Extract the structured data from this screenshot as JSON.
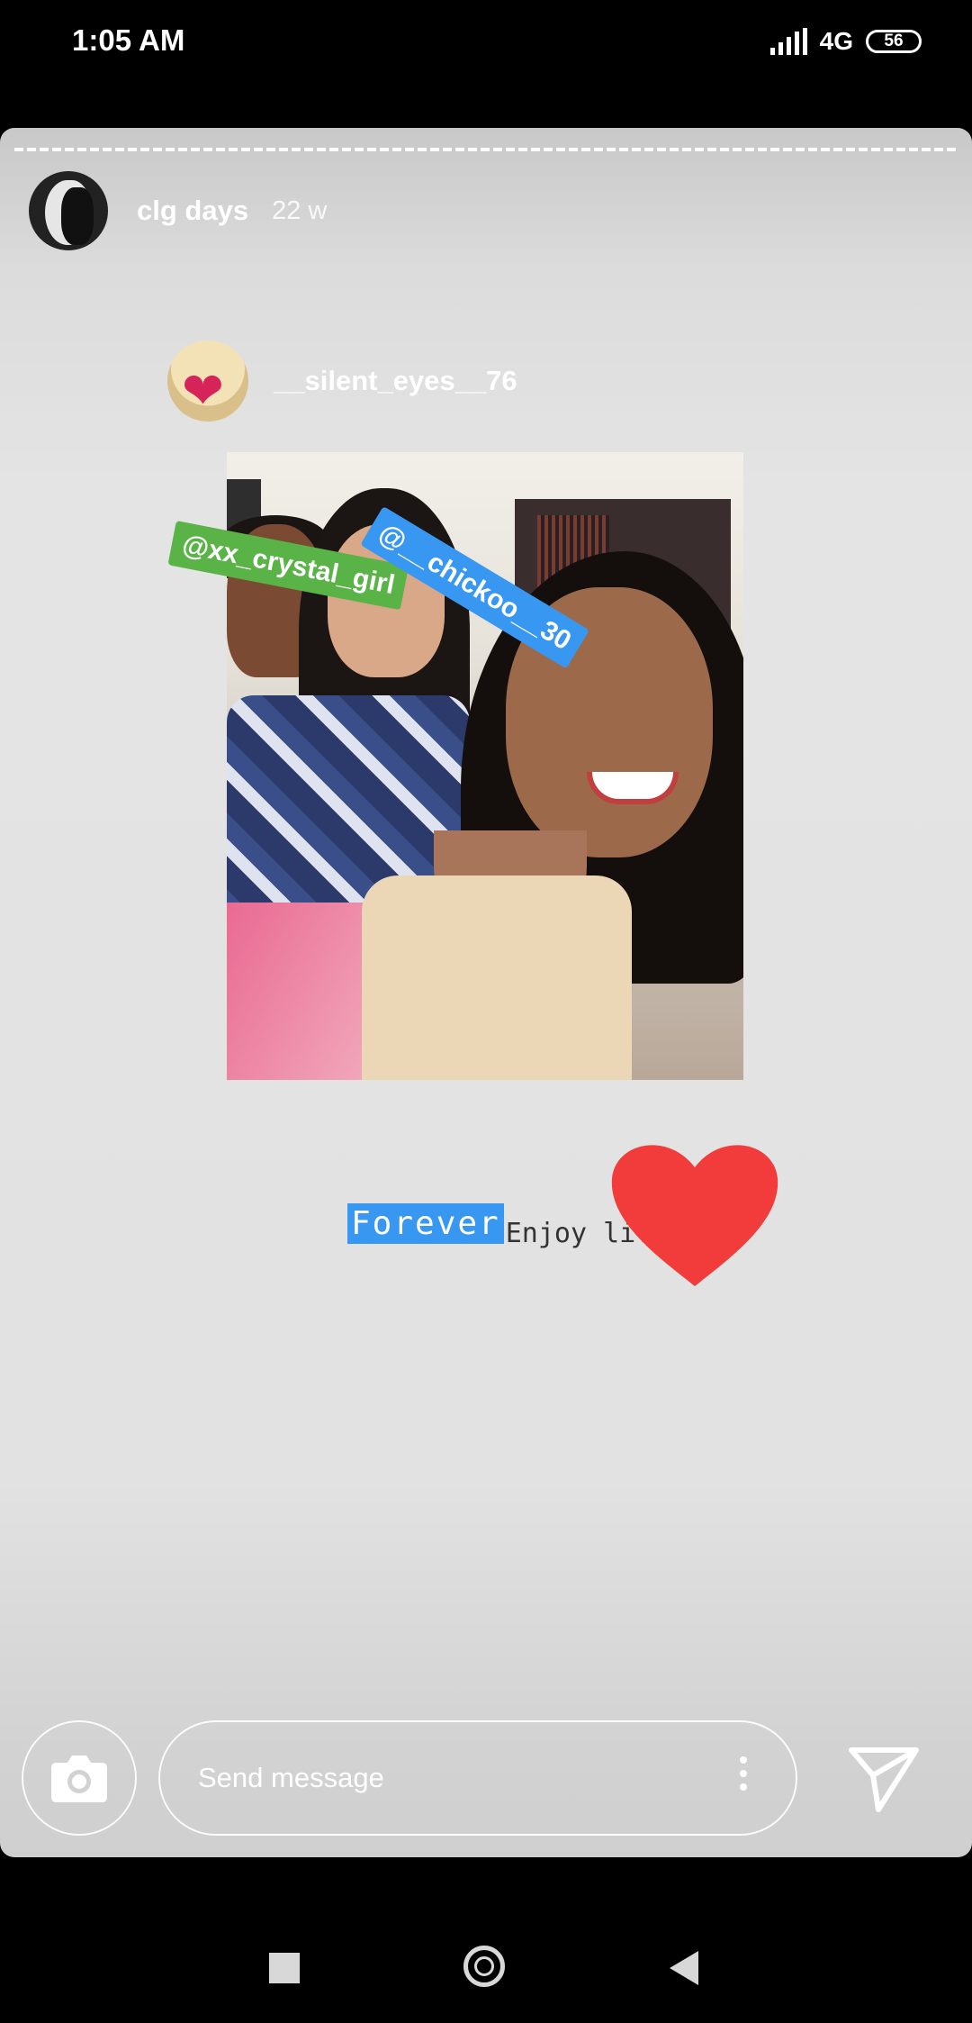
{
  "status_bar": {
    "time": "1:05 AM",
    "network": "4G",
    "battery": "56"
  },
  "story": {
    "username": "clg days",
    "time_ago": "22 w",
    "mention_username": "__silent_eyes__76",
    "tags": [
      "@xx_crystal_girl",
      "@__chickoo__30"
    ],
    "caption_highlight": "Forever",
    "caption_text": "Enjoy life"
  },
  "message_bar": {
    "placeholder": "Send message"
  },
  "colors": {
    "tag_green": "#5ab347",
    "tag_blue": "#3897f0",
    "heart": "#f23c3c"
  },
  "icons": [
    "camera-icon",
    "more-vertical-icon",
    "send-icon",
    "heart-sticker",
    "recents-icon",
    "home-icon",
    "back-icon"
  ]
}
